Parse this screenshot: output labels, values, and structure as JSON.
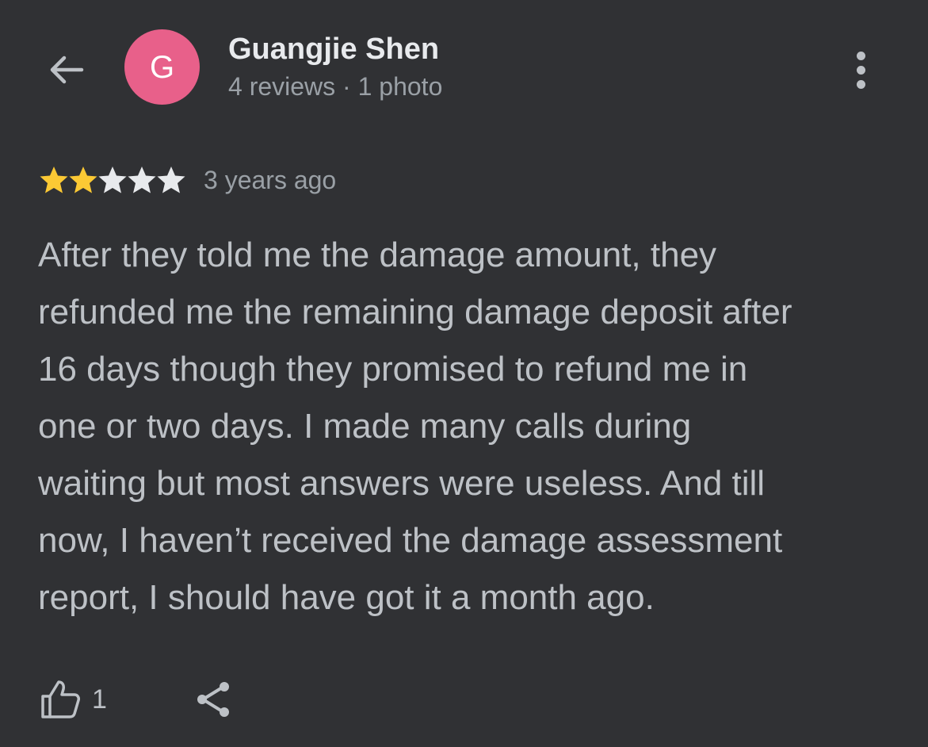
{
  "header": {
    "back_icon": "arrow-back-icon",
    "avatar_letter": "G",
    "avatar_color": "#e8608a",
    "user_name": "Guangjie Shen",
    "user_meta": "4 reviews · 1 photo",
    "more_icon": "more-vert-icon"
  },
  "review": {
    "rating": 2,
    "max_rating": 5,
    "star_filled_color": "#fcc934",
    "star_empty_color": "#e8eaed",
    "time": "3 years ago",
    "text": "After they told me the damage amount, they\nrefunded me the remaining damage deposit after\n16 days though they promised to refund me in\none or two days. I made many calls during\nwaiting but most answers were useless. And till\nnow, I haven’t received the damage assessment\nreport, I should have got it a month ago."
  },
  "actions": {
    "like_icon": "thumb-up-icon",
    "like_count": "1",
    "share_icon": "share-icon"
  }
}
